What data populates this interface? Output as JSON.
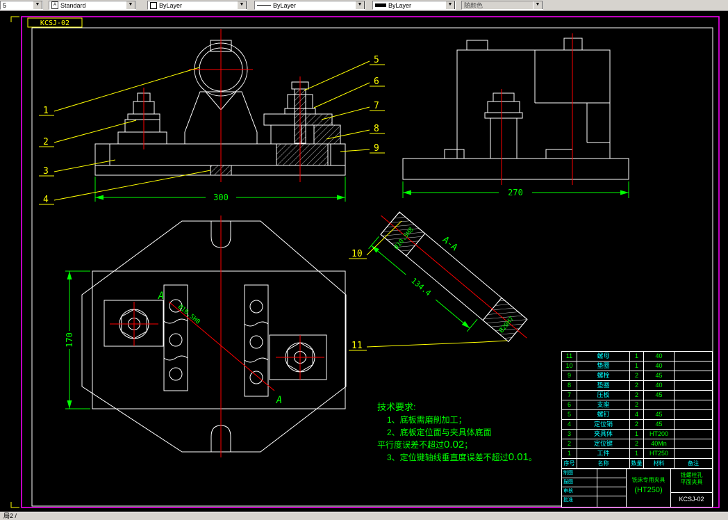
{
  "window": {
    "statusbar_text": "局2 /"
  },
  "toolbar": {
    "combos": [
      {
        "value": "5"
      },
      {
        "value": "Standard"
      },
      {
        "value": "ByLayer"
      },
      {
        "value": "ByLayer"
      },
      {
        "value": "ByLayer"
      },
      {
        "value": "随颜色"
      }
    ]
  },
  "drawing": {
    "doc_code": "KCSJ-02",
    "dimensions": {
      "front_width": "300",
      "side_width": "270",
      "plan_height": "170",
      "section_length": "134.4"
    },
    "labels": {
      "section": "A-A",
      "section_arrow": "A",
      "plan_note": "Ø10.5H8",
      "end_note_upper": "Ø10.5H8",
      "end_note_lower": "Ø20H7"
    },
    "callouts": [
      "1",
      "2",
      "3",
      "4",
      "5",
      "6",
      "7",
      "8",
      "9",
      "10",
      "11"
    ],
    "tech": {
      "title": "技术要求:",
      "item1": "1、底板需磨削加工；",
      "item2a": "2、底板定位面与夹具体底面",
      "item2b_pre": "平行度误差不超过",
      "item2b_val": "0.02",
      "item2b_suf": "；",
      "item3_pre": "3、定位键轴线垂直度误差不超过",
      "item3_val": "0.01",
      "item3_suf": "。"
    },
    "parts_table": {
      "header": [
        "序号",
        "名称",
        "数量",
        "材料",
        "备注"
      ],
      "rows": [
        {
          "no": "11",
          "name": "螺母",
          "qty": "1",
          "material": "40",
          "note": ""
        },
        {
          "no": "10",
          "name": "垫圈",
          "qty": "1",
          "material": "40",
          "note": ""
        },
        {
          "no": "9",
          "name": "螺栓",
          "qty": "2",
          "material": "45",
          "note": ""
        },
        {
          "no": "8",
          "name": "垫圈",
          "qty": "2",
          "material": "40",
          "note": ""
        },
        {
          "no": "7",
          "name": "压板",
          "qty": "2",
          "material": "45",
          "note": ""
        },
        {
          "no": "6",
          "name": "支座",
          "qty": "2",
          "material": "",
          "note": ""
        },
        {
          "no": "5",
          "name": "螺钉",
          "qty": "4",
          "material": "45",
          "note": ""
        },
        {
          "no": "4",
          "name": "定位销",
          "qty": "2",
          "material": "45",
          "note": ""
        },
        {
          "no": "3",
          "name": "夹具体",
          "qty": "1",
          "material": "HT200",
          "note": ""
        },
        {
          "no": "2",
          "name": "定位键",
          "qty": "2",
          "material": "40Mn",
          "note": ""
        },
        {
          "no": "1",
          "name": "工件",
          "qty": "1",
          "material": "HT250",
          "note": ""
        }
      ]
    },
    "title_block": {
      "left_rows": [
        {
          "label": "制图"
        },
        {
          "label": "描图"
        },
        {
          "label": "审核"
        },
        {
          "label": "批准"
        }
      ],
      "name_line1": "铣床专用夹具",
      "name_line2": "(HT250)",
      "right_line1": "铣螺栓孔",
      "right_line2": "平面夹具",
      "code": "KCSJ-02"
    }
  }
}
